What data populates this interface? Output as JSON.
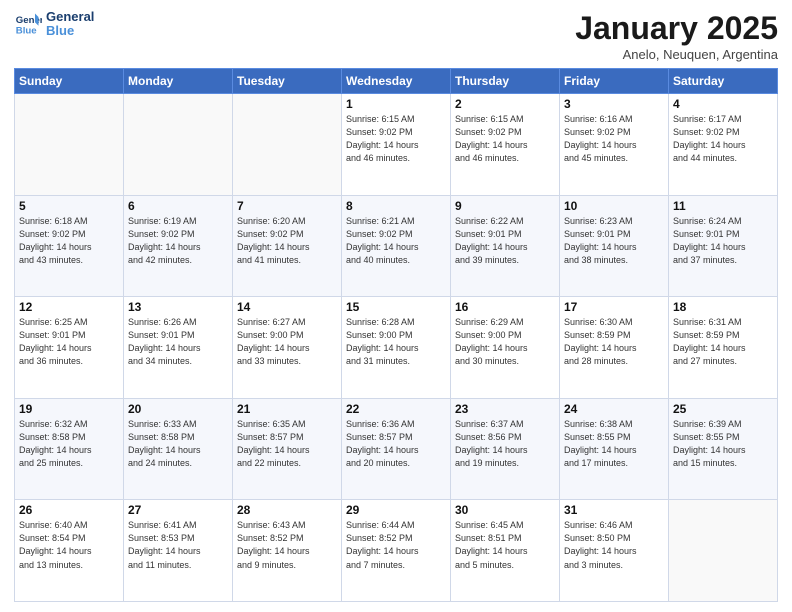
{
  "logo": {
    "line1": "General",
    "line2": "Blue"
  },
  "title": "January 2025",
  "subtitle": "Anelo, Neuquen, Argentina",
  "weekdays": [
    "Sunday",
    "Monday",
    "Tuesday",
    "Wednesday",
    "Thursday",
    "Friday",
    "Saturday"
  ],
  "weeks": [
    [
      {
        "day": "",
        "info": ""
      },
      {
        "day": "",
        "info": ""
      },
      {
        "day": "",
        "info": ""
      },
      {
        "day": "1",
        "info": "Sunrise: 6:15 AM\nSunset: 9:02 PM\nDaylight: 14 hours\nand 46 minutes."
      },
      {
        "day": "2",
        "info": "Sunrise: 6:15 AM\nSunset: 9:02 PM\nDaylight: 14 hours\nand 46 minutes."
      },
      {
        "day": "3",
        "info": "Sunrise: 6:16 AM\nSunset: 9:02 PM\nDaylight: 14 hours\nand 45 minutes."
      },
      {
        "day": "4",
        "info": "Sunrise: 6:17 AM\nSunset: 9:02 PM\nDaylight: 14 hours\nand 44 minutes."
      }
    ],
    [
      {
        "day": "5",
        "info": "Sunrise: 6:18 AM\nSunset: 9:02 PM\nDaylight: 14 hours\nand 43 minutes."
      },
      {
        "day": "6",
        "info": "Sunrise: 6:19 AM\nSunset: 9:02 PM\nDaylight: 14 hours\nand 42 minutes."
      },
      {
        "day": "7",
        "info": "Sunrise: 6:20 AM\nSunset: 9:02 PM\nDaylight: 14 hours\nand 41 minutes."
      },
      {
        "day": "8",
        "info": "Sunrise: 6:21 AM\nSunset: 9:02 PM\nDaylight: 14 hours\nand 40 minutes."
      },
      {
        "day": "9",
        "info": "Sunrise: 6:22 AM\nSunset: 9:01 PM\nDaylight: 14 hours\nand 39 minutes."
      },
      {
        "day": "10",
        "info": "Sunrise: 6:23 AM\nSunset: 9:01 PM\nDaylight: 14 hours\nand 38 minutes."
      },
      {
        "day": "11",
        "info": "Sunrise: 6:24 AM\nSunset: 9:01 PM\nDaylight: 14 hours\nand 37 minutes."
      }
    ],
    [
      {
        "day": "12",
        "info": "Sunrise: 6:25 AM\nSunset: 9:01 PM\nDaylight: 14 hours\nand 36 minutes."
      },
      {
        "day": "13",
        "info": "Sunrise: 6:26 AM\nSunset: 9:01 PM\nDaylight: 14 hours\nand 34 minutes."
      },
      {
        "day": "14",
        "info": "Sunrise: 6:27 AM\nSunset: 9:00 PM\nDaylight: 14 hours\nand 33 minutes."
      },
      {
        "day": "15",
        "info": "Sunrise: 6:28 AM\nSunset: 9:00 PM\nDaylight: 14 hours\nand 31 minutes."
      },
      {
        "day": "16",
        "info": "Sunrise: 6:29 AM\nSunset: 9:00 PM\nDaylight: 14 hours\nand 30 minutes."
      },
      {
        "day": "17",
        "info": "Sunrise: 6:30 AM\nSunset: 8:59 PM\nDaylight: 14 hours\nand 28 minutes."
      },
      {
        "day": "18",
        "info": "Sunrise: 6:31 AM\nSunset: 8:59 PM\nDaylight: 14 hours\nand 27 minutes."
      }
    ],
    [
      {
        "day": "19",
        "info": "Sunrise: 6:32 AM\nSunset: 8:58 PM\nDaylight: 14 hours\nand 25 minutes."
      },
      {
        "day": "20",
        "info": "Sunrise: 6:33 AM\nSunset: 8:58 PM\nDaylight: 14 hours\nand 24 minutes."
      },
      {
        "day": "21",
        "info": "Sunrise: 6:35 AM\nSunset: 8:57 PM\nDaylight: 14 hours\nand 22 minutes."
      },
      {
        "day": "22",
        "info": "Sunrise: 6:36 AM\nSunset: 8:57 PM\nDaylight: 14 hours\nand 20 minutes."
      },
      {
        "day": "23",
        "info": "Sunrise: 6:37 AM\nSunset: 8:56 PM\nDaylight: 14 hours\nand 19 minutes."
      },
      {
        "day": "24",
        "info": "Sunrise: 6:38 AM\nSunset: 8:55 PM\nDaylight: 14 hours\nand 17 minutes."
      },
      {
        "day": "25",
        "info": "Sunrise: 6:39 AM\nSunset: 8:55 PM\nDaylight: 14 hours\nand 15 minutes."
      }
    ],
    [
      {
        "day": "26",
        "info": "Sunrise: 6:40 AM\nSunset: 8:54 PM\nDaylight: 14 hours\nand 13 minutes."
      },
      {
        "day": "27",
        "info": "Sunrise: 6:41 AM\nSunset: 8:53 PM\nDaylight: 14 hours\nand 11 minutes."
      },
      {
        "day": "28",
        "info": "Sunrise: 6:43 AM\nSunset: 8:52 PM\nDaylight: 14 hours\nand 9 minutes."
      },
      {
        "day": "29",
        "info": "Sunrise: 6:44 AM\nSunset: 8:52 PM\nDaylight: 14 hours\nand 7 minutes."
      },
      {
        "day": "30",
        "info": "Sunrise: 6:45 AM\nSunset: 8:51 PM\nDaylight: 14 hours\nand 5 minutes."
      },
      {
        "day": "31",
        "info": "Sunrise: 6:46 AM\nSunset: 8:50 PM\nDaylight: 14 hours\nand 3 minutes."
      },
      {
        "day": "",
        "info": ""
      }
    ]
  ]
}
